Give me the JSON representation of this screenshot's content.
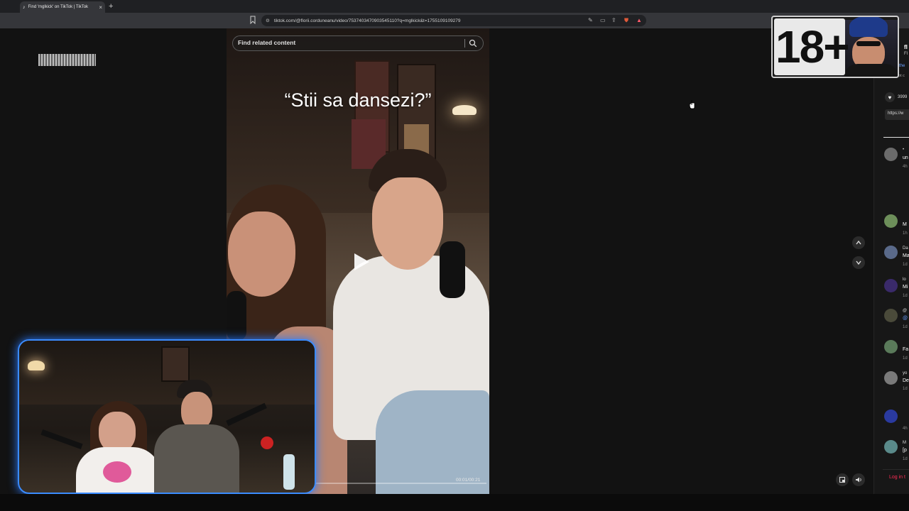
{
  "browser": {
    "tab_title": "Find 'mglkick' on TikTok | TikTok",
    "tab_close": "×",
    "new_tab": "+",
    "url": "tiktok.com/@florii.corduneanu/video/7537403470903545110?q=mglkick&t=1755109109279"
  },
  "page": {
    "search_placeholder": "Find related content",
    "caption": "“Stii sa dansezi?”",
    "timecode": "00:01/00:21"
  },
  "overlay": {
    "age_badge": "18+"
  },
  "sidebar": {
    "header_initial": "fl",
    "header_sub": "Fl",
    "link_text": "the",
    "translate_text": "not c",
    "likes": "3999",
    "copy_link": "https://w",
    "login": "Log in t",
    "comments": [
      {
        "name": "•",
        "text": "un",
        "time": "4h"
      },
      {
        "name": "",
        "text": "M",
        "time": "1h"
      },
      {
        "name": "Da",
        "text": "Ma",
        "time": "1d"
      },
      {
        "name": "lo",
        "text": "Mi",
        "time": "1d"
      },
      {
        "name": "@",
        "text": "@",
        "time": "1d"
      },
      {
        "name": "",
        "text": "Fa",
        "time": "1d"
      },
      {
        "name": "yo",
        "text": "De",
        "time": "1d"
      },
      {
        "name": "",
        "text": "",
        "time": "4h"
      },
      {
        "name": "M",
        "text": "[p",
        "time": "1d"
      }
    ]
  },
  "colors": {
    "accent_pink": "#fe2c55",
    "webcam_border": "#3b8cff"
  }
}
